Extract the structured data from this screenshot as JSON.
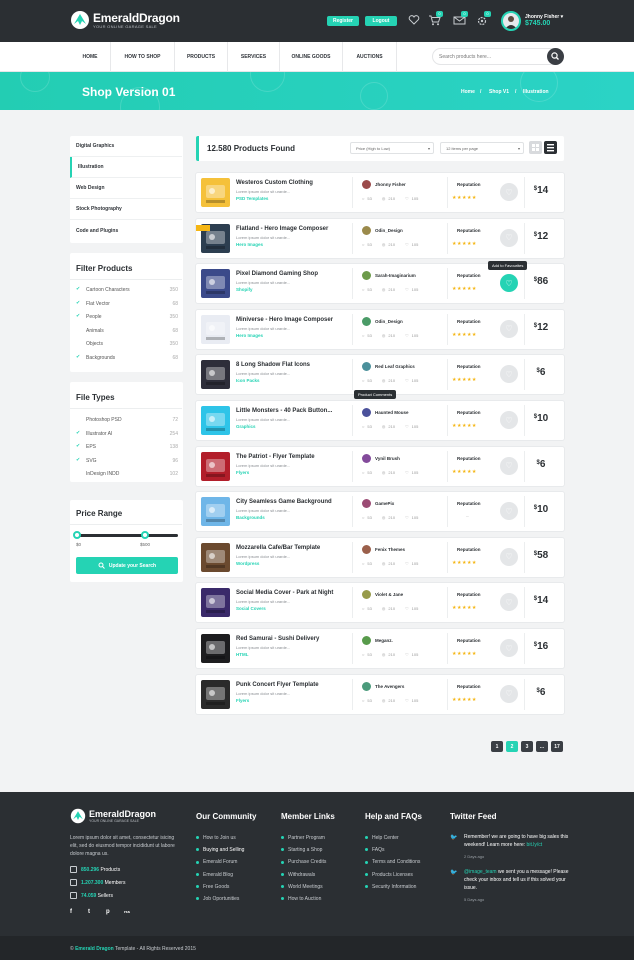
{
  "header": {
    "brand": "EmeraldDragon",
    "brand_tag": "YOUR ONLINE GARAGE SALE",
    "register_label": "Register",
    "logout_label": "Logout",
    "icons": [
      {
        "name": "heart-icon",
        "badge": ""
      },
      {
        "name": "cart-icon",
        "badge": "0"
      },
      {
        "name": "message-icon",
        "badge": "0"
      },
      {
        "name": "settings-icon",
        "badge": "0"
      }
    ],
    "user_name": "Jhonny Fisher",
    "user_balance": "$745.00"
  },
  "nav": {
    "items": [
      "HOME",
      "HOW TO SHOP",
      "PRODUCTS",
      "SERVICES",
      "ONLINE GOODS",
      "AUCTIONS"
    ],
    "search_placeholder": "Search products here..."
  },
  "banner": {
    "title": "Shop Version 01",
    "crumbs": [
      "Home",
      "Shop V1",
      "Illustration"
    ]
  },
  "sidebar": {
    "categories": [
      "Digital Graphics",
      "Illustration",
      "Web Design",
      "Stock Photography",
      "Code and Plugins"
    ],
    "active_category": "Illustration",
    "filter_title": "Filter Products",
    "filters": [
      {
        "label": "Cartoon Characters",
        "count": "350",
        "checked": true
      },
      {
        "label": "Flat Vector",
        "count": "68",
        "checked": true
      },
      {
        "label": "People",
        "count": "350",
        "checked": true
      },
      {
        "label": "Animals",
        "count": "68",
        "checked": false
      },
      {
        "label": "Objects",
        "count": "350",
        "checked": false
      },
      {
        "label": "Backgrounds",
        "count": "68",
        "checked": true
      }
    ],
    "filetypes_title": "File Types",
    "filetypes": [
      {
        "label": "Photoshop PSD",
        "count": "72",
        "checked": false
      },
      {
        "label": "Illustrator AI",
        "count": "254",
        "checked": true
      },
      {
        "label": "EPS",
        "count": "138",
        "checked": true
      },
      {
        "label": "SVG",
        "count": "96",
        "checked": true
      },
      {
        "label": "InDesign INDD",
        "count": "102",
        "checked": false
      }
    ],
    "price_title": "Price Range",
    "price_min": "$0",
    "price_max": "$500",
    "price_low_fraction": 0.0,
    "price_high_fraction": 0.67,
    "update_label": "Update your Search"
  },
  "results": {
    "count_text": "12.580 Products Found",
    "sort_value": "Price (High to Low)",
    "per_page_value": "12 items per page"
  },
  "products": [
    {
      "name": "Westeros Custom Clothing",
      "desc": "Lorem ipsum dolor sit urarde...",
      "category": "PSD Templates",
      "author": "Jhonny Fisher",
      "comments": "53",
      "views": "210",
      "likes": "105",
      "rating": 5,
      "price": "14",
      "fav": false,
      "thumb": "#f5c13a"
    },
    {
      "name": "Flatland - Hero Image Composer",
      "desc": "Lorem ipsum dolor sit urarde...",
      "category": "Hero Images",
      "author": "Odin_Design",
      "comments": "53",
      "views": "210",
      "likes": "105",
      "rating": 5,
      "price": "12",
      "fav": false,
      "thumb": "#2c3e50"
    },
    {
      "name": "Pixel Diamond Gaming Shop",
      "desc": "Lorem ipsum dolor sit urarde...",
      "category": "Shopify",
      "author": "Sarah-Imaginarium",
      "comments": "53",
      "views": "210",
      "likes": "105",
      "rating": 5,
      "price": "86",
      "fav": true,
      "thumb": "#3b4a8a"
    },
    {
      "name": "Miniverse - Hero Image Composer",
      "desc": "Lorem ipsum dolor sit urarde...",
      "category": "Hero Images",
      "author": "Odin_Design",
      "comments": "53",
      "views": "210",
      "likes": "105",
      "rating": 5,
      "price": "12",
      "fav": false,
      "thumb": "#e9ecf3"
    },
    {
      "name": "8 Long Shadow Flat Icons",
      "desc": "Lorem ipsum dolor sit urarde...",
      "category": "Icon Packs",
      "author": "Red Leaf Graphics",
      "comments": "53",
      "views": "210",
      "likes": "105",
      "rating": 5,
      "price": "6",
      "fav": false,
      "thumb": "#2e2e3a"
    },
    {
      "name": "Little Monsters - 40 Pack Button...",
      "desc": "Lorem ipsum dolor sit urarde...",
      "category": "Graphics",
      "author": "Haunted Mouse",
      "comments": "53",
      "views": "210",
      "likes": "105",
      "rating": 5,
      "price": "10",
      "fav": false,
      "thumb": "#2ec4e8"
    },
    {
      "name": "The Patriot - Flyer Template",
      "desc": "Lorem ipsum dolor sit urarde...",
      "category": "Flyers",
      "author": "Vynil Brush",
      "comments": "53",
      "views": "210",
      "likes": "105",
      "rating": 5,
      "price": "6",
      "fav": false,
      "thumb": "#b21e2a"
    },
    {
      "name": "City Seamless Game Background",
      "desc": "Lorem ipsum dolor sit urarde...",
      "category": "Backgrounds",
      "author": "GamePix",
      "comments": "53",
      "views": "210",
      "likes": "105",
      "rating": 0,
      "price": "10",
      "fav": false,
      "thumb": "#6fb6e8"
    },
    {
      "name": "Mozzarella Cafe/Bar Template",
      "desc": "Lorem ipsum dolor sit urarde...",
      "category": "Wordpress",
      "author": "Fenix Themes",
      "comments": "53",
      "views": "210",
      "likes": "105",
      "rating": 5,
      "price": "58",
      "fav": false,
      "thumb": "#6b4a2f"
    },
    {
      "name": "Social Media Cover - Park at Night",
      "desc": "Lorem ipsum dolor sit urarde...",
      "category": "Social Covers",
      "author": "Violet & Jane",
      "comments": "53",
      "views": "210",
      "likes": "105",
      "rating": 5,
      "price": "14",
      "fav": false,
      "thumb": "#3a2a6a"
    },
    {
      "name": "Red Samurai - Sushi Delivery",
      "desc": "Lorem ipsum dolor sit urarde...",
      "category": "HTML",
      "author": "Meganz.",
      "comments": "53",
      "views": "210",
      "likes": "105",
      "rating": 5,
      "price": "16",
      "fav": false,
      "thumb": "#1d1d1f"
    },
    {
      "name": "Punk Concert Flyer Template",
      "desc": "Lorem ipsum dolor sit urarde...",
      "category": "Flyers",
      "author": "The Avengers",
      "comments": "53",
      "views": "210",
      "likes": "105",
      "rating": 5,
      "price": "6",
      "fav": false,
      "thumb": "#2a2a2a"
    }
  ],
  "reputation_label": "Reputation",
  "tooltips": {
    "favourite": "Add to Favourites",
    "comments": "Product Comments"
  },
  "pagination": [
    "1",
    "2",
    "3",
    "...",
    "17"
  ],
  "pagination_active": "2",
  "footer": {
    "brand": "EmeraldDragon",
    "brand_tag": "YOUR ONLINE GARAGE SALE",
    "desc": "Lorem ipsum dolor sit amet, consectetur isicing elit, sed do eiusmod tempor incididunt ut labore dolore magna us.",
    "stats": [
      {
        "value": "850.296",
        "label": " Products"
      },
      {
        "value": "1.207.300",
        "label": " Members"
      },
      {
        "value": "74.059",
        "label": " Sellers"
      }
    ],
    "social": [
      "f",
      "t",
      "p",
      "rss"
    ],
    "community_title": "Our Community",
    "community": [
      "How to Join us",
      "Buying and Selling",
      "Emerald Forum",
      "Emerald Blog",
      "Free Goods",
      "Job Oportunities"
    ],
    "members_title": "Member Links",
    "members": [
      "Partner Program",
      "Starting a Shop",
      "Purchase Credits",
      "Withdrawals",
      "World Meetings",
      "How to Auction"
    ],
    "help_title": "Help and FAQs",
    "help": [
      "Help Center",
      "FAQs",
      "Terms and Conditions",
      "Products Licenses",
      "Security Information"
    ],
    "twitter_title": "Twitter Feed",
    "tweets": [
      {
        "text": "Remember! we are going to have big sales this weekend! Learn more here: ",
        "link": "bit.ly/ct",
        "handle": "",
        "date": "2 Days ago"
      },
      {
        "text": " we sent you a message! Please check your inbox and tell us if this solved your issue.",
        "link": "",
        "handle": "@image_team",
        "date": "5 Days ago"
      }
    ],
    "copyright_brand": "Emerald Dragon",
    "copyright": " Template - All Rights Reserved 2015"
  },
  "colors": {
    "accent": "#25d3b4",
    "dark": "#2b2f33",
    "star": "#f5b614"
  }
}
